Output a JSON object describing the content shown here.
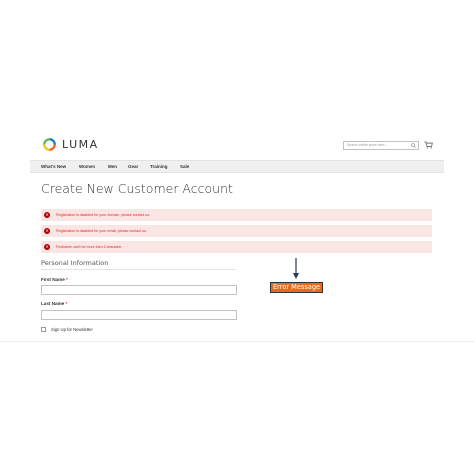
{
  "header": {
    "logo_text": "LUMA",
    "search_placeholder": "Search entire store here...",
    "logo_colors": [
      "#f26322",
      "#f7c21c",
      "#5db84a",
      "#1979c3"
    ]
  },
  "nav": {
    "items": [
      "What's New",
      "Women",
      "Men",
      "Gear",
      "Training",
      "Sale"
    ]
  },
  "page": {
    "title": "Create New Customer Account"
  },
  "errors": [
    "Registration is disabled for your domain, please contact us.",
    "Registration is disabled for your email, please contact us.",
    "Firstname can't be more then 5 character"
  ],
  "form": {
    "fieldset_title": "Personal Information",
    "first_name_label": "First Name",
    "first_name_required": "*",
    "last_name_label": "Last Name",
    "last_name_required": "*",
    "newsletter_label": "Sign Up for Newsletter"
  },
  "annotation": {
    "label": "Error Message",
    "color": "#e86b1a"
  },
  "colors": {
    "error_bg": "#fae5e5",
    "error_text": "#e02b27",
    "error_icon": "#b30000"
  }
}
